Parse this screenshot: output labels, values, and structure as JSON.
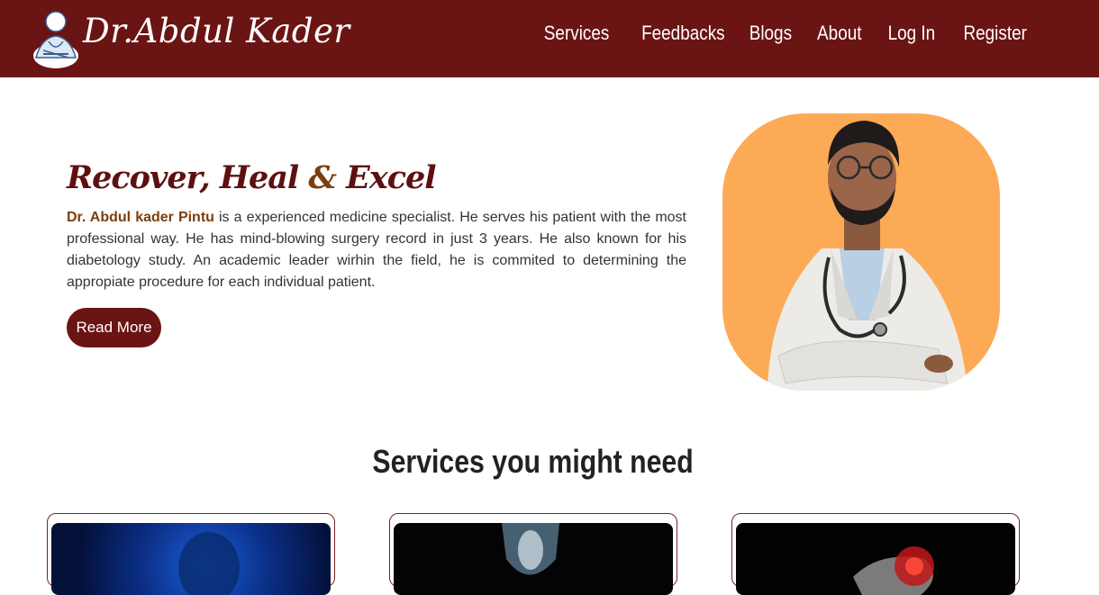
{
  "brand": {
    "name": "Dr.Abdul Kader"
  },
  "nav": {
    "items": [
      {
        "label": "Services"
      },
      {
        "label": "Feedbacks"
      },
      {
        "label": "Blogs"
      },
      {
        "label": "About"
      },
      {
        "label": "Log In"
      },
      {
        "label": "Register"
      }
    ]
  },
  "hero": {
    "title_part1": "Recover, Heal ",
    "title_amp": "&",
    "title_part2": " Excel",
    "doctor_name": "Dr. Abdul kader Pintu",
    "description": " is a experienced medicine specialist. He serves his patient with the most professional way. He has mind-blowing surgery record in just 3 years. He also known for his diabetology study. An academic leader wirhin the field, he is commited to determining the appropiate procedure for each individual patient.",
    "button_label": "Read More"
  },
  "services": {
    "title": "Services you might need"
  },
  "colors": {
    "primary": "#6b1414",
    "accent": "#7a3f10",
    "photo_bg": "#fdaa57"
  }
}
